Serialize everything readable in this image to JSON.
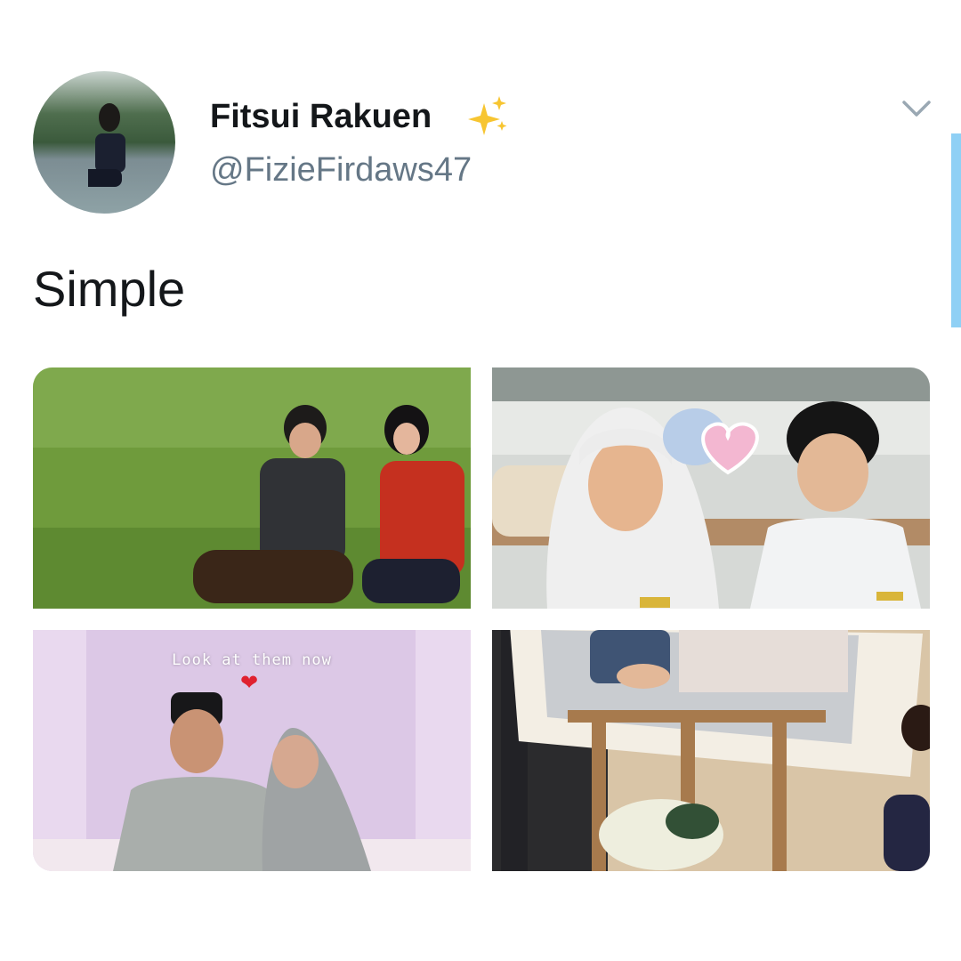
{
  "user": {
    "display_name": "Fitsui Rakuen",
    "handle": "@FizieFirdaws47",
    "name_emoji": "sparkles-icon"
  },
  "tweet": {
    "text": "Simple"
  },
  "menu": {
    "icon": "chevron-down-icon"
  },
  "media": {
    "photo_3_caption": "Look at them now",
    "photo_3_emoji": "❤"
  },
  "colors": {
    "handle": "#657786",
    "text": "#14171a",
    "scroll_indicator": "#8fd0f5"
  }
}
